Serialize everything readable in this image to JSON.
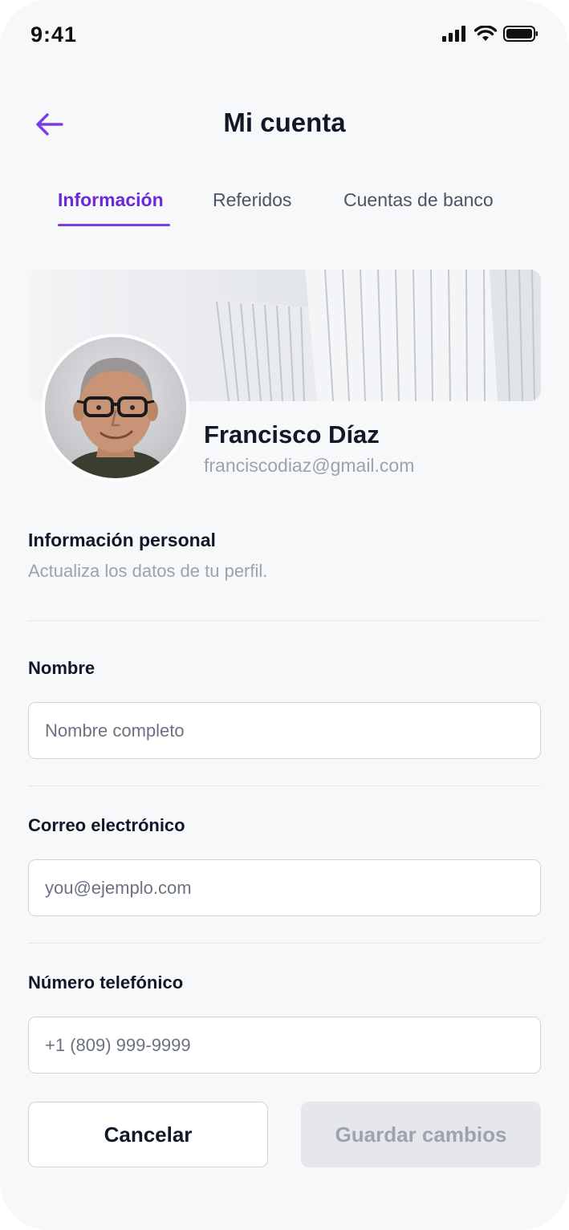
{
  "status_bar": {
    "time": "9:41",
    "icons": [
      "signal-icon",
      "wifi-icon",
      "battery-icon"
    ]
  },
  "header": {
    "title": "Mi cuenta",
    "back_icon": "arrow-left-icon"
  },
  "tabs": [
    {
      "label": "Información",
      "active": true
    },
    {
      "label": "Referidos",
      "active": false
    },
    {
      "label": "Cuentas de banco",
      "active": false
    }
  ],
  "profile": {
    "name": "Francisco Díaz",
    "email": "franciscodiaz@gmail.com"
  },
  "section": {
    "title": "Información personal",
    "subtitle": "Actualiza los datos de tu perfil."
  },
  "form": {
    "name": {
      "label": "Nombre",
      "placeholder": "Nombre completo",
      "value": ""
    },
    "email": {
      "label": "Correo electrónico",
      "placeholder": "you@ejemplo.com",
      "value": ""
    },
    "phone": {
      "label": "Número telefónico",
      "placeholder": "+1 (809) 999-9999",
      "value": ""
    }
  },
  "actions": {
    "cancel_label": "Cancelar",
    "save_label": "Guardar cambios"
  },
  "colors": {
    "accent": "#6d28d9",
    "background": "#f7f8fa",
    "disabled_bg": "#e5e7eb",
    "disabled_text": "#9ca3af"
  }
}
